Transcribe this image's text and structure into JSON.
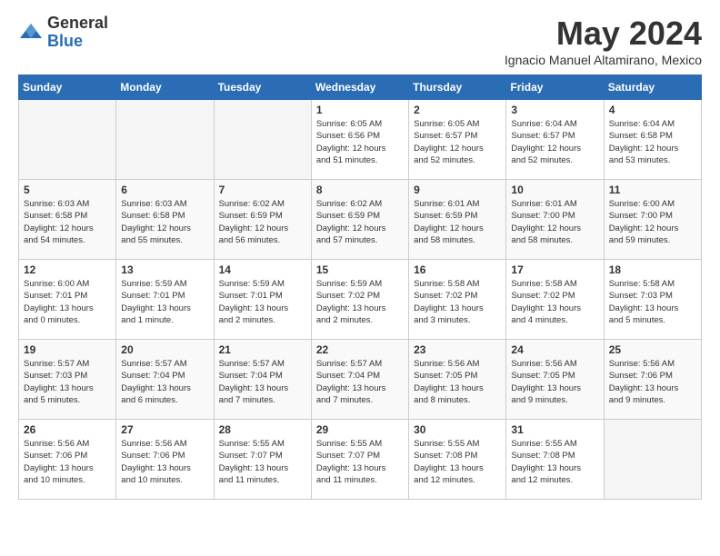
{
  "logo": {
    "general": "General",
    "blue": "Blue"
  },
  "title": {
    "month": "May 2024",
    "location": "Ignacio Manuel Altamirano, Mexico"
  },
  "weekdays": [
    "Sunday",
    "Monday",
    "Tuesday",
    "Wednesday",
    "Thursday",
    "Friday",
    "Saturday"
  ],
  "weeks": [
    [
      {
        "day": "",
        "info": ""
      },
      {
        "day": "",
        "info": ""
      },
      {
        "day": "",
        "info": ""
      },
      {
        "day": "1",
        "info": "Sunrise: 6:05 AM\nSunset: 6:56 PM\nDaylight: 12 hours\nand 51 minutes."
      },
      {
        "day": "2",
        "info": "Sunrise: 6:05 AM\nSunset: 6:57 PM\nDaylight: 12 hours\nand 52 minutes."
      },
      {
        "day": "3",
        "info": "Sunrise: 6:04 AM\nSunset: 6:57 PM\nDaylight: 12 hours\nand 52 minutes."
      },
      {
        "day": "4",
        "info": "Sunrise: 6:04 AM\nSunset: 6:58 PM\nDaylight: 12 hours\nand 53 minutes."
      }
    ],
    [
      {
        "day": "5",
        "info": "Sunrise: 6:03 AM\nSunset: 6:58 PM\nDaylight: 12 hours\nand 54 minutes."
      },
      {
        "day": "6",
        "info": "Sunrise: 6:03 AM\nSunset: 6:58 PM\nDaylight: 12 hours\nand 55 minutes."
      },
      {
        "day": "7",
        "info": "Sunrise: 6:02 AM\nSunset: 6:59 PM\nDaylight: 12 hours\nand 56 minutes."
      },
      {
        "day": "8",
        "info": "Sunrise: 6:02 AM\nSunset: 6:59 PM\nDaylight: 12 hours\nand 57 minutes."
      },
      {
        "day": "9",
        "info": "Sunrise: 6:01 AM\nSunset: 6:59 PM\nDaylight: 12 hours\nand 58 minutes."
      },
      {
        "day": "10",
        "info": "Sunrise: 6:01 AM\nSunset: 7:00 PM\nDaylight: 12 hours\nand 58 minutes."
      },
      {
        "day": "11",
        "info": "Sunrise: 6:00 AM\nSunset: 7:00 PM\nDaylight: 12 hours\nand 59 minutes."
      }
    ],
    [
      {
        "day": "12",
        "info": "Sunrise: 6:00 AM\nSunset: 7:01 PM\nDaylight: 13 hours\nand 0 minutes."
      },
      {
        "day": "13",
        "info": "Sunrise: 5:59 AM\nSunset: 7:01 PM\nDaylight: 13 hours\nand 1 minute."
      },
      {
        "day": "14",
        "info": "Sunrise: 5:59 AM\nSunset: 7:01 PM\nDaylight: 13 hours\nand 2 minutes."
      },
      {
        "day": "15",
        "info": "Sunrise: 5:59 AM\nSunset: 7:02 PM\nDaylight: 13 hours\nand 2 minutes."
      },
      {
        "day": "16",
        "info": "Sunrise: 5:58 AM\nSunset: 7:02 PM\nDaylight: 13 hours\nand 3 minutes."
      },
      {
        "day": "17",
        "info": "Sunrise: 5:58 AM\nSunset: 7:02 PM\nDaylight: 13 hours\nand 4 minutes."
      },
      {
        "day": "18",
        "info": "Sunrise: 5:58 AM\nSunset: 7:03 PM\nDaylight: 13 hours\nand 5 minutes."
      }
    ],
    [
      {
        "day": "19",
        "info": "Sunrise: 5:57 AM\nSunset: 7:03 PM\nDaylight: 13 hours\nand 5 minutes."
      },
      {
        "day": "20",
        "info": "Sunrise: 5:57 AM\nSunset: 7:04 PM\nDaylight: 13 hours\nand 6 minutes."
      },
      {
        "day": "21",
        "info": "Sunrise: 5:57 AM\nSunset: 7:04 PM\nDaylight: 13 hours\nand 7 minutes."
      },
      {
        "day": "22",
        "info": "Sunrise: 5:57 AM\nSunset: 7:04 PM\nDaylight: 13 hours\nand 7 minutes."
      },
      {
        "day": "23",
        "info": "Sunrise: 5:56 AM\nSunset: 7:05 PM\nDaylight: 13 hours\nand 8 minutes."
      },
      {
        "day": "24",
        "info": "Sunrise: 5:56 AM\nSunset: 7:05 PM\nDaylight: 13 hours\nand 9 minutes."
      },
      {
        "day": "25",
        "info": "Sunrise: 5:56 AM\nSunset: 7:06 PM\nDaylight: 13 hours\nand 9 minutes."
      }
    ],
    [
      {
        "day": "26",
        "info": "Sunrise: 5:56 AM\nSunset: 7:06 PM\nDaylight: 13 hours\nand 10 minutes."
      },
      {
        "day": "27",
        "info": "Sunrise: 5:56 AM\nSunset: 7:06 PM\nDaylight: 13 hours\nand 10 minutes."
      },
      {
        "day": "28",
        "info": "Sunrise: 5:55 AM\nSunset: 7:07 PM\nDaylight: 13 hours\nand 11 minutes."
      },
      {
        "day": "29",
        "info": "Sunrise: 5:55 AM\nSunset: 7:07 PM\nDaylight: 13 hours\nand 11 minutes."
      },
      {
        "day": "30",
        "info": "Sunrise: 5:55 AM\nSunset: 7:08 PM\nDaylight: 13 hours\nand 12 minutes."
      },
      {
        "day": "31",
        "info": "Sunrise: 5:55 AM\nSunset: 7:08 PM\nDaylight: 13 hours\nand 12 minutes."
      },
      {
        "day": "",
        "info": ""
      }
    ]
  ]
}
